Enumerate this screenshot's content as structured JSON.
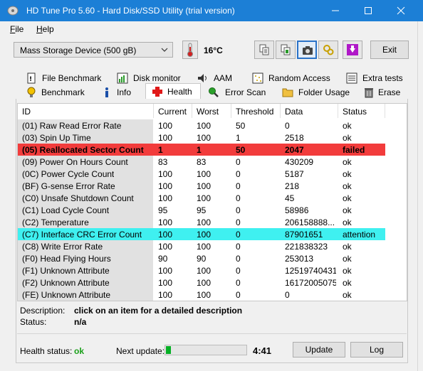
{
  "window": {
    "title": "HD Tune Pro 5.60 - Hard Disk/SSD Utility (trial version)",
    "accent": "#1c7fd6"
  },
  "menu": {
    "items": [
      {
        "label": "File",
        "u": "F",
        "rest": "ile"
      },
      {
        "label": "Help",
        "u": "H",
        "rest": "elp"
      }
    ]
  },
  "toolbar": {
    "drive": "Mass Storage Device (500 gB)",
    "temperature": "16°C",
    "exit_label": "Exit",
    "icons": [
      "copy-text-icon",
      "copy-screenshot-icon",
      "camera-icon",
      "options-icon",
      "save-icon"
    ]
  },
  "tabs": {
    "row1": [
      {
        "label": "File Benchmark",
        "icon": "file-benchmark-icon"
      },
      {
        "label": "Disk monitor",
        "icon": "disk-monitor-icon"
      },
      {
        "label": "AAM",
        "icon": "speaker-icon"
      },
      {
        "label": "Random Access",
        "icon": "random-access-icon"
      },
      {
        "label": "Extra tests",
        "icon": "extra-tests-icon"
      }
    ],
    "row2": [
      {
        "label": "Benchmark",
        "icon": "benchmark-icon"
      },
      {
        "label": "Info",
        "icon": "info-icon"
      },
      {
        "label": "Health",
        "icon": "health-cross-icon"
      },
      {
        "label": "Error Scan",
        "icon": "error-scan-icon"
      },
      {
        "label": "Folder Usage",
        "icon": "folder-icon"
      },
      {
        "label": "Erase",
        "icon": "trash-icon"
      }
    ],
    "selected": "Health"
  },
  "table": {
    "columns": [
      "ID",
      "Current",
      "Worst",
      "Threshold",
      "Data",
      "Status"
    ],
    "rows": [
      {
        "id": "(01) Raw Read Error Rate",
        "current": "100",
        "worst": "100",
        "threshold": "50",
        "data": "0",
        "status": "ok"
      },
      {
        "id": "(03) Spin Up Time",
        "current": "100",
        "worst": "100",
        "threshold": "1",
        "data": "2518",
        "status": "ok"
      },
      {
        "id": "(05) Reallocated Sector Count",
        "current": "1",
        "worst": "1",
        "threshold": "50",
        "data": "2047",
        "status": "failed",
        "highlight": "#f23c3c"
      },
      {
        "id": "(09) Power On Hours Count",
        "current": "83",
        "worst": "83",
        "threshold": "0",
        "data": "430209",
        "status": "ok"
      },
      {
        "id": "(0C) Power Cycle Count",
        "current": "100",
        "worst": "100",
        "threshold": "0",
        "data": "5187",
        "status": "ok"
      },
      {
        "id": "(BF) G-sense Error Rate",
        "current": "100",
        "worst": "100",
        "threshold": "0",
        "data": "218",
        "status": "ok"
      },
      {
        "id": "(C0) Unsafe Shutdown Count",
        "current": "100",
        "worst": "100",
        "threshold": "0",
        "data": "45",
        "status": "ok"
      },
      {
        "id": "(C1) Load Cycle Count",
        "current": "95",
        "worst": "95",
        "threshold": "0",
        "data": "58986",
        "status": "ok"
      },
      {
        "id": "(C2) Temperature",
        "current": "100",
        "worst": "100",
        "threshold": "0",
        "data": "206158888...",
        "status": "ok"
      },
      {
        "id": "(C7) Interface CRC Error Count",
        "current": "100",
        "worst": "100",
        "threshold": "0",
        "data": "87901651",
        "status": "attention",
        "highlight": "#3ff0f0"
      },
      {
        "id": "(C8) Write Error Rate",
        "current": "100",
        "worst": "100",
        "threshold": "0",
        "data": "221838323",
        "status": "ok"
      },
      {
        "id": "(F0) Head Flying Hours",
        "current": "90",
        "worst": "90",
        "threshold": "0",
        "data": "253013",
        "status": "ok"
      },
      {
        "id": "(F1) Unknown Attribute",
        "current": "100",
        "worst": "100",
        "threshold": "0",
        "data": "12519740431",
        "status": "ok"
      },
      {
        "id": "(F2) Unknown Attribute",
        "current": "100",
        "worst": "100",
        "threshold": "0",
        "data": "16172005075",
        "status": "ok"
      },
      {
        "id": "(FE) Unknown Attribute",
        "current": "100",
        "worst": "100",
        "threshold": "0",
        "data": "0",
        "status": "ok"
      }
    ]
  },
  "details": {
    "description_label": "Description:",
    "description_value": "click on an item for a detailed description",
    "status_label": "Status:",
    "status_value": "n/a"
  },
  "footer": {
    "health_label": "Health status:",
    "health_value": "ok",
    "next_update_label": "Next update:",
    "progress_fraction": 0.06,
    "countdown": "4:41",
    "update_label": "Update",
    "log_label": "Log"
  }
}
